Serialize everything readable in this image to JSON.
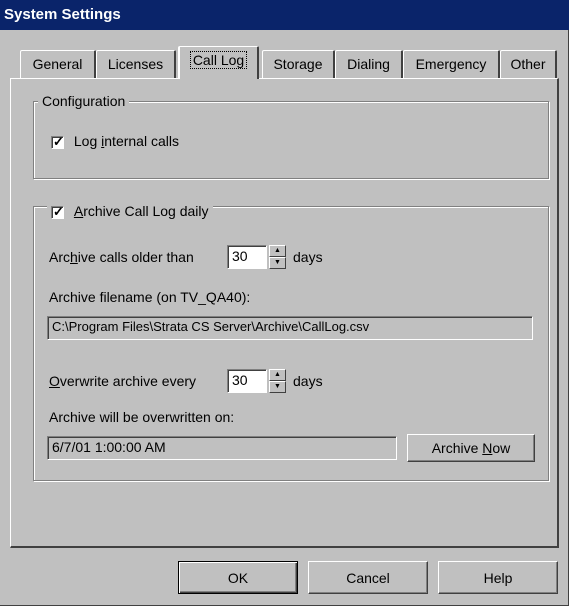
{
  "window": {
    "title": "System Settings"
  },
  "tabs": [
    {
      "label": "General"
    },
    {
      "label": "Licenses"
    },
    {
      "label": "Call Log"
    },
    {
      "label": "Storage"
    },
    {
      "label": "Dialing"
    },
    {
      "label": "Emergency"
    },
    {
      "label": "Other"
    }
  ],
  "active_tab": "Call Log",
  "configuration": {
    "legend": "Configuration",
    "log_internal_calls": {
      "label_pre": "Log ",
      "label_u": "i",
      "label_post": "nternal calls",
      "checked": true
    }
  },
  "archive": {
    "legend_pre": "",
    "legend_u": "A",
    "legend_post": "rchive Call Log daily",
    "checked": true,
    "older_than": {
      "label_pre": "Arc",
      "label_u": "h",
      "label_post": "ive calls older than",
      "value": "30",
      "unit": "days"
    },
    "filename_label": "Archive filename (on TV_QA40):",
    "filename_value": "C:\\Program Files\\Strata CS Server\\Archive\\CallLog.csv",
    "overwrite": {
      "label_pre": "",
      "label_u": "O",
      "label_post": "verwrite archive every",
      "value": "30",
      "unit": "days"
    },
    "overwritten_on_label": "Archive will be overwritten on:",
    "overwritten_on_value": "6/7/01 1:00:00 AM",
    "archive_now": {
      "label_pre": "Archive ",
      "label_u": "N",
      "label_post": "ow"
    }
  },
  "buttons": {
    "ok": "OK",
    "cancel": "Cancel",
    "help": "Help"
  }
}
